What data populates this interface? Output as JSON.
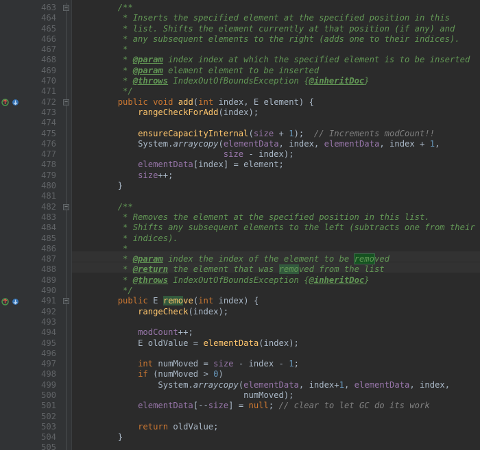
{
  "first_line": 463,
  "last_line": 505,
  "search": {
    "query": "remo",
    "current_hit_line": 487
  },
  "gutter_icons": {
    "472": [
      "implements",
      "overrides"
    ],
    "491": [
      "implements",
      "overrides"
    ]
  },
  "fold_markers": {
    "463": "open",
    "472": "open",
    "482": "open",
    "491": "open"
  },
  "highlighted_lines": [
    487,
    488
  ],
  "lines": {
    "463": [
      [
        "doc",
        "        /**"
      ]
    ],
    "464": [
      [
        "doc",
        "         * Inserts the specified element at the specified position in this"
      ]
    ],
    "465": [
      [
        "doc",
        "         * list. Shifts the element currently at that position (if any) and"
      ]
    ],
    "466": [
      [
        "doc",
        "         * any subsequent elements to the right (adds one to their indices)."
      ]
    ],
    "467": [
      [
        "doc",
        "         *"
      ]
    ],
    "468": [
      [
        "doc",
        "         * "
      ],
      [
        "doctag",
        "@param"
      ],
      [
        "doc",
        " index index at which the specified element is to be inserted"
      ]
    ],
    "469": [
      [
        "doc",
        "         * "
      ],
      [
        "doctag",
        "@param"
      ],
      [
        "doc",
        " element element to be inserted"
      ]
    ],
    "470": [
      [
        "doc",
        "         * "
      ],
      [
        "doctag",
        "@throws"
      ],
      [
        "doc",
        " IndexOutOfBoundsException {"
      ],
      [
        "doclink",
        "@inheritDoc"
      ],
      [
        "doc",
        "}"
      ]
    ],
    "471": [
      [
        "doc",
        "         */"
      ]
    ],
    "472": [
      [
        "plain",
        "        "
      ],
      [
        "kw",
        "public"
      ],
      [
        "plain",
        " "
      ],
      [
        "kw",
        "void"
      ],
      [
        "plain",
        " "
      ],
      [
        "methoddef",
        "add"
      ],
      [
        "punct",
        "("
      ],
      [
        "kw",
        "int"
      ],
      [
        "plain",
        " index"
      ],
      [
        "punct",
        ", "
      ],
      [
        "type",
        "E"
      ],
      [
        "plain",
        " element"
      ],
      [
        "punct",
        ") {"
      ]
    ],
    "473": [
      [
        "plain",
        "            "
      ],
      [
        "method",
        "rangeCheckForAdd"
      ],
      [
        "punct",
        "("
      ],
      [
        "plain",
        "index"
      ],
      [
        "punct",
        ");"
      ]
    ],
    "474": [
      [
        "plain",
        ""
      ]
    ],
    "475": [
      [
        "plain",
        "            "
      ],
      [
        "method",
        "ensureCapacityInternal"
      ],
      [
        "punct",
        "("
      ],
      [
        "field",
        "size"
      ],
      [
        "plain",
        " + "
      ],
      [
        "num",
        "1"
      ],
      [
        "punct",
        ");  "
      ],
      [
        "comment",
        "// Increments modCount!!"
      ]
    ],
    "476": [
      [
        "plain",
        "            "
      ],
      [
        "type",
        "System"
      ],
      [
        "punct",
        "."
      ],
      [
        "static",
        "arraycopy"
      ],
      [
        "punct",
        "("
      ],
      [
        "field",
        "elementData"
      ],
      [
        "punct",
        ", "
      ],
      [
        "plain",
        "index"
      ],
      [
        "punct",
        ", "
      ],
      [
        "field",
        "elementData"
      ],
      [
        "punct",
        ", "
      ],
      [
        "plain",
        "index + "
      ],
      [
        "num",
        "1"
      ],
      [
        "punct",
        ","
      ]
    ],
    "477": [
      [
        "plain",
        "                             "
      ],
      [
        "field",
        "size"
      ],
      [
        "plain",
        " - index"
      ],
      [
        "punct",
        ");"
      ]
    ],
    "478": [
      [
        "plain",
        "            "
      ],
      [
        "field",
        "elementData"
      ],
      [
        "punct",
        "["
      ],
      [
        "plain",
        "index"
      ],
      [
        "punct",
        "] = "
      ],
      [
        "plain",
        "element"
      ],
      [
        "punct",
        ";"
      ]
    ],
    "479": [
      [
        "plain",
        "            "
      ],
      [
        "field",
        "size"
      ],
      [
        "punct",
        "++;"
      ]
    ],
    "480": [
      [
        "plain",
        "        "
      ],
      [
        "punct",
        "}"
      ]
    ],
    "481": [
      [
        "plain",
        ""
      ]
    ],
    "482": [
      [
        "doc",
        "        /**"
      ]
    ],
    "483": [
      [
        "doc",
        "         * Removes the element at the specified position in this list."
      ]
    ],
    "484": [
      [
        "doc",
        "         * Shifts any subsequent elements to the left (subtracts one from their"
      ]
    ],
    "485": [
      [
        "doc",
        "         * indices)."
      ]
    ],
    "486": [
      [
        "doc",
        "         *"
      ]
    ],
    "487": [
      [
        "doc",
        "         * "
      ],
      [
        "doctag",
        "@param"
      ],
      [
        "doc",
        " index the index of the element to be "
      ],
      [
        "hit_current",
        "remo"
      ],
      [
        "doc",
        "ved"
      ]
    ],
    "488": [
      [
        "doc",
        "         * "
      ],
      [
        "doctag",
        "@return"
      ],
      [
        "doc",
        " the element that was "
      ],
      [
        "hit",
        "remo"
      ],
      [
        "doc",
        "ved from the list"
      ]
    ],
    "489": [
      [
        "doc",
        "         * "
      ],
      [
        "doctag",
        "@throws"
      ],
      [
        "doc",
        " IndexOutOfBoundsException {"
      ],
      [
        "doclink",
        "@inheritDoc"
      ],
      [
        "doc",
        "}"
      ]
    ],
    "490": [
      [
        "doc",
        "         */"
      ]
    ],
    "491": [
      [
        "plain",
        "        "
      ],
      [
        "kw",
        "public"
      ],
      [
        "plain",
        " "
      ],
      [
        "type",
        "E"
      ],
      [
        "plain",
        " "
      ],
      [
        "methoddef",
        "remo"
      ],
      [
        "methoddef_hit",
        "ve"
      ],
      [
        "punct",
        "("
      ],
      [
        "kw",
        "int"
      ],
      [
        "plain",
        " index"
      ],
      [
        "punct",
        ") {"
      ]
    ],
    "492": [
      [
        "plain",
        "            "
      ],
      [
        "method",
        "rangeCheck"
      ],
      [
        "punct",
        "("
      ],
      [
        "plain",
        "index"
      ],
      [
        "punct",
        ");"
      ]
    ],
    "493": [
      [
        "plain",
        ""
      ]
    ],
    "494": [
      [
        "plain",
        "            "
      ],
      [
        "field",
        "modCount"
      ],
      [
        "punct",
        "++;"
      ]
    ],
    "495": [
      [
        "plain",
        "            "
      ],
      [
        "type",
        "E"
      ],
      [
        "plain",
        " oldValue = "
      ],
      [
        "method",
        "elementData"
      ],
      [
        "punct",
        "("
      ],
      [
        "plain",
        "index"
      ],
      [
        "punct",
        ");"
      ]
    ],
    "496": [
      [
        "plain",
        ""
      ]
    ],
    "497": [
      [
        "plain",
        "            "
      ],
      [
        "kw",
        "int"
      ],
      [
        "plain",
        " numMoved = "
      ],
      [
        "field",
        "size"
      ],
      [
        "plain",
        " - index - "
      ],
      [
        "num",
        "1"
      ],
      [
        "punct",
        ";"
      ]
    ],
    "498": [
      [
        "plain",
        "            "
      ],
      [
        "kw",
        "if"
      ],
      [
        "plain",
        " (numMoved > "
      ],
      [
        "num",
        "0"
      ],
      [
        "punct",
        ")"
      ]
    ],
    "499": [
      [
        "plain",
        "                "
      ],
      [
        "type",
        "System"
      ],
      [
        "punct",
        "."
      ],
      [
        "static",
        "arraycopy"
      ],
      [
        "punct",
        "("
      ],
      [
        "field",
        "elementData"
      ],
      [
        "punct",
        ", "
      ],
      [
        "plain",
        "index+"
      ],
      [
        "num",
        "1"
      ],
      [
        "punct",
        ", "
      ],
      [
        "field",
        "elementData"
      ],
      [
        "punct",
        ", "
      ],
      [
        "plain",
        "index"
      ],
      [
        "punct",
        ","
      ]
    ],
    "500": [
      [
        "plain",
        "                                 numMoved"
      ],
      [
        "punct",
        ");"
      ]
    ],
    "501": [
      [
        "plain",
        "            "
      ],
      [
        "field",
        "elementData"
      ],
      [
        "punct",
        "[--"
      ],
      [
        "field",
        "size"
      ],
      [
        "punct",
        "] = "
      ],
      [
        "kw",
        "null"
      ],
      [
        "punct",
        "; "
      ],
      [
        "comment",
        "// clear to let GC do its work"
      ]
    ],
    "502": [
      [
        "plain",
        ""
      ]
    ],
    "503": [
      [
        "plain",
        "            "
      ],
      [
        "kw",
        "return"
      ],
      [
        "plain",
        " oldValue"
      ],
      [
        "punct",
        ";"
      ]
    ],
    "504": [
      [
        "plain",
        "        "
      ],
      [
        "punct",
        "}"
      ]
    ],
    "505": [
      [
        "plain",
        ""
      ]
    ]
  }
}
